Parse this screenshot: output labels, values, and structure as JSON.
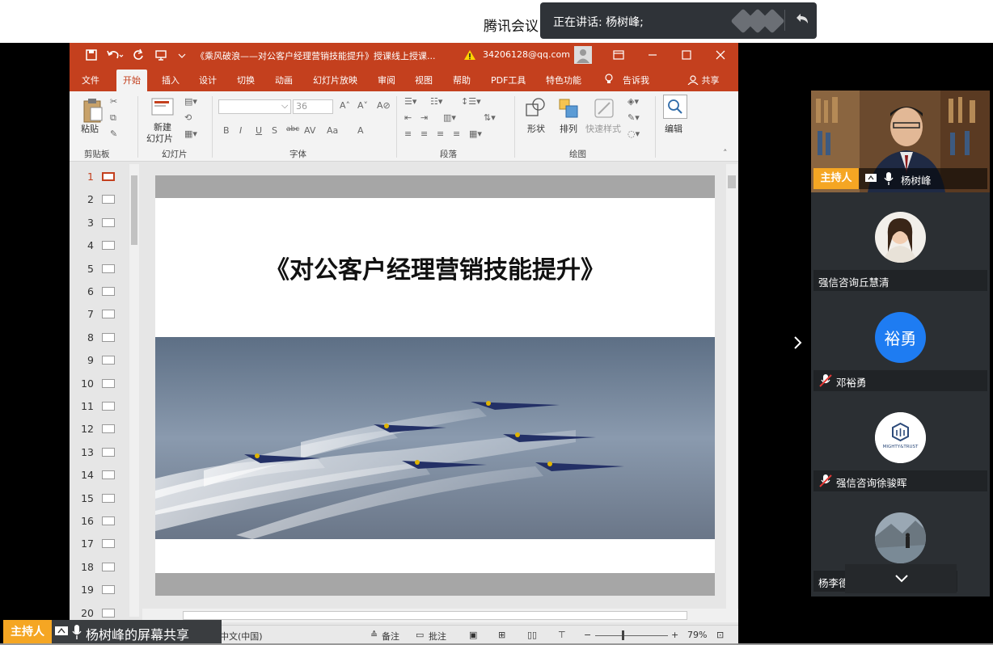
{
  "meeting": {
    "app_title": "腾讯会议",
    "speaking_label": "正在讲话: 杨树峰;"
  },
  "ppt": {
    "window_title": "《乘风破浪——对公客户经理营销技能提升》授课线上授课...",
    "account": "34206128@qq.com",
    "tabs": [
      "文件",
      "开始",
      "插入",
      "设计",
      "切换",
      "动画",
      "幻灯片放映",
      "审阅",
      "视图",
      "帮助",
      "PDF工具",
      "特色功能",
      "告诉我",
      "共享"
    ],
    "active_tab": "开始",
    "groups": {
      "clipboard": "剪贴板",
      "slides": "幻灯片",
      "font": "字体",
      "paragraph": "段落",
      "drawing": "绘图"
    },
    "buttons": {
      "paste": "粘贴",
      "new_slide_line1": "新建",
      "new_slide_line2": "幻灯片",
      "shape": "形状",
      "arrange": "排列",
      "quick_style": "快速样式",
      "edit": "编辑"
    },
    "font_size": "36",
    "font_style_labels": [
      "B",
      "I",
      "U",
      "S",
      "abc",
      "AV",
      "Aa",
      "A"
    ],
    "slide_numbers": [
      "1",
      "2",
      "3",
      "4",
      "5",
      "6",
      "7",
      "8",
      "9",
      "10",
      "11",
      "12",
      "13",
      "14",
      "15",
      "16",
      "17",
      "18",
      "19",
      "20"
    ],
    "active_slide": 1,
    "slide_title": "《对公客户经理营销技能提升》",
    "status": {
      "language": "中文(中国)",
      "notes": "备注",
      "comments": "批注",
      "zoom": "79%"
    }
  },
  "participants": [
    {
      "name": "杨树峰",
      "role": "主持人",
      "avatar_text": ""
    },
    {
      "name": "强信咨询丘慧清",
      "role": "",
      "avatar_text": ""
    },
    {
      "name": "邓裕勇",
      "role": "",
      "avatar_text": "裕勇",
      "avatar_color": "#1e7cf2"
    },
    {
      "name": "强信咨询徐骏晖",
      "role": "",
      "avatar_text": "MIGHTY&TRUST"
    },
    {
      "name": "杨李德",
      "role": "",
      "avatar_text": ""
    }
  ],
  "share_indicator": {
    "role": "主持人",
    "text": "杨树峰的屏幕共享"
  },
  "colors": {
    "ppt_red": "#c4401e",
    "host_orange": "#f5a623",
    "panel_bg": "#2b2f33"
  }
}
